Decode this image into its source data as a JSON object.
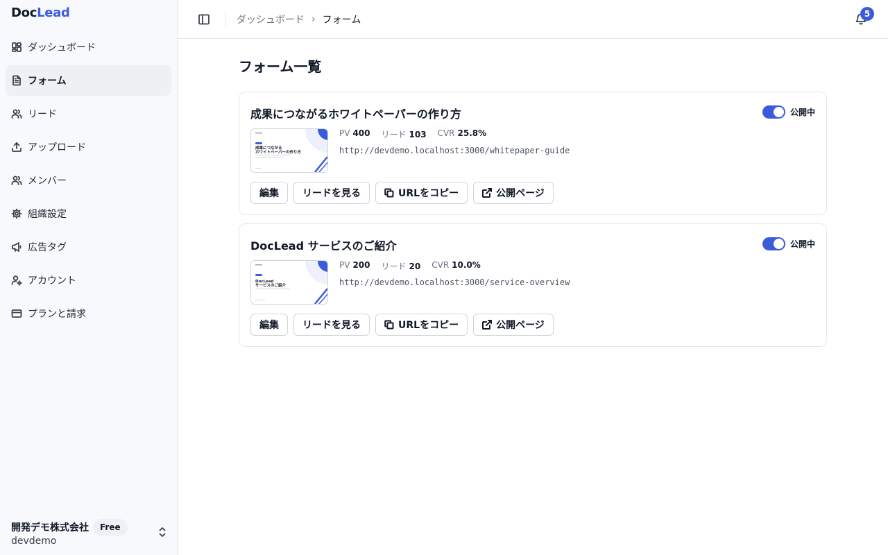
{
  "app": {
    "logo_part1": "Doc",
    "logo_part2": "Lead"
  },
  "sidebar": {
    "items": [
      {
        "label": "ダッシュボード",
        "icon": "dashboard-icon"
      },
      {
        "label": "フォーム",
        "icon": "file-icon",
        "active": true
      },
      {
        "label": "リード",
        "icon": "users-icon"
      },
      {
        "label": "アップロード",
        "icon": "upload-icon"
      },
      {
        "label": "メンバー",
        "icon": "users-icon"
      },
      {
        "label": "組織設定",
        "icon": "gear-icon"
      },
      {
        "label": "広告タグ",
        "icon": "megaphone-icon"
      },
      {
        "label": "アカウント",
        "icon": "user-cog-icon"
      },
      {
        "label": "プランと請求",
        "icon": "credit-card-icon"
      }
    ],
    "org": {
      "name": "開発デモ株式会社",
      "plan": "Free",
      "slug": "devdemo"
    }
  },
  "header": {
    "breadcrumb": [
      "ダッシュボード",
      "フォーム"
    ],
    "notification_count": "5"
  },
  "main": {
    "title": "フォーム一覧",
    "forms": [
      {
        "title": "成果につながるホワイトペーパーの作り方",
        "status": "公開中",
        "published": true,
        "stats": [
          {
            "label": "PV",
            "value": "400"
          },
          {
            "label": "リード",
            "value": "103"
          },
          {
            "label": "CVR",
            "value": "25.8%"
          }
        ],
        "url": "http://devdemo.localhost:3000/whitepaper-guide",
        "thumb_lines": [
          "成果につながる",
          "ホワイトペーパーの作り方"
        ]
      },
      {
        "title": "DocLead サービスのご紹介",
        "status": "公開中",
        "published": true,
        "stats": [
          {
            "label": "PV",
            "value": "200"
          },
          {
            "label": "リード",
            "value": "20"
          },
          {
            "label": "CVR",
            "value": "10.0%"
          }
        ],
        "url": "http://devdemo.localhost:3000/service-overview",
        "thumb_lines": [
          "DocLead",
          "サービスのご紹介"
        ]
      }
    ],
    "actions": {
      "edit": "編集",
      "view_leads": "リードを見る",
      "copy_url": "URLをコピー",
      "public_page": "公開ページ"
    }
  },
  "colors": {
    "accent": "#3b5bdb",
    "sidebar_bg": "#f8f9fc",
    "border": "#e5e7eb"
  }
}
